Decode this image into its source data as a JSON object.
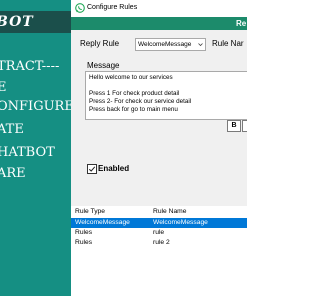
{
  "promo": {
    "title": "BOT",
    "lines": [
      "TRACT----",
      "E",
      "ONFIGURE",
      "ATE",
      "HATBOT",
      "ARE"
    ]
  },
  "window": {
    "title": "Configure Rules",
    "header_text": "Re"
  },
  "form": {
    "reply_rule_label": "Reply Rule",
    "reply_rule_value": "WelcomeMessage",
    "rule_name_label": "Rule Nar",
    "message_label": "Message",
    "message_lines": [
      "Hello welcome to our services",
      "",
      "Press 1 For check product detail",
      "Press 2- For check our service detail",
      "Press back for go to main menu"
    ],
    "bold_button": "B",
    "enabled_label": "Enabled",
    "enabled_checked": true
  },
  "table": {
    "columns": [
      "Rule Type",
      "Rule Name"
    ],
    "rows": [
      {
        "type": "WelcomeMessage",
        "name": "WelcomeMessage",
        "selected": true
      },
      {
        "type": "Rules",
        "name": "rule",
        "selected": false
      },
      {
        "type": "Rules",
        "name": "rule 2",
        "selected": false
      }
    ]
  },
  "colors": {
    "promo_bg": "#158f83",
    "promo_title_bg": "#1b4f4b",
    "header_green": "#1c8b6b",
    "selection": "#0078d7"
  }
}
